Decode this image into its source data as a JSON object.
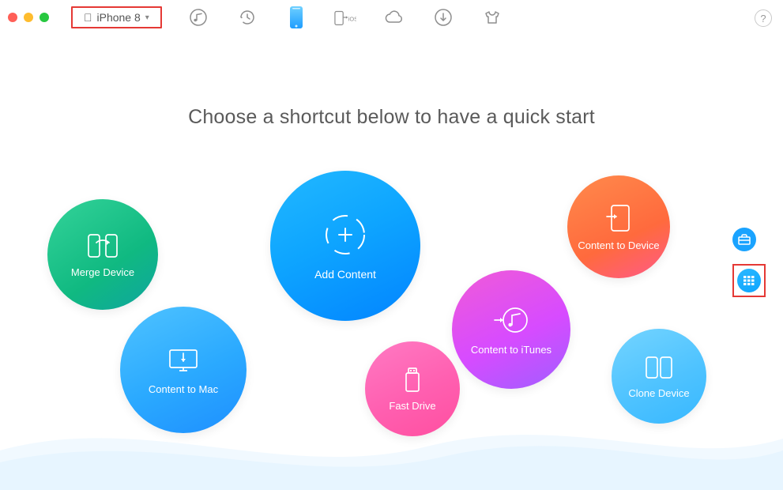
{
  "device_selector": {
    "label": "iPhone 8"
  },
  "heading": "Choose a shortcut below to have a quick start",
  "shortcuts": {
    "merge": {
      "label": "Merge Device"
    },
    "add": {
      "label": "Add Content"
    },
    "c2device": {
      "label": "Content to Device"
    },
    "c2mac": {
      "label": "Content to Mac"
    },
    "c2itunes": {
      "label": "Content to iTunes"
    },
    "fastdrive": {
      "label": "Fast Drive"
    },
    "clone": {
      "label": "Clone Device"
    }
  },
  "help_label": "?"
}
